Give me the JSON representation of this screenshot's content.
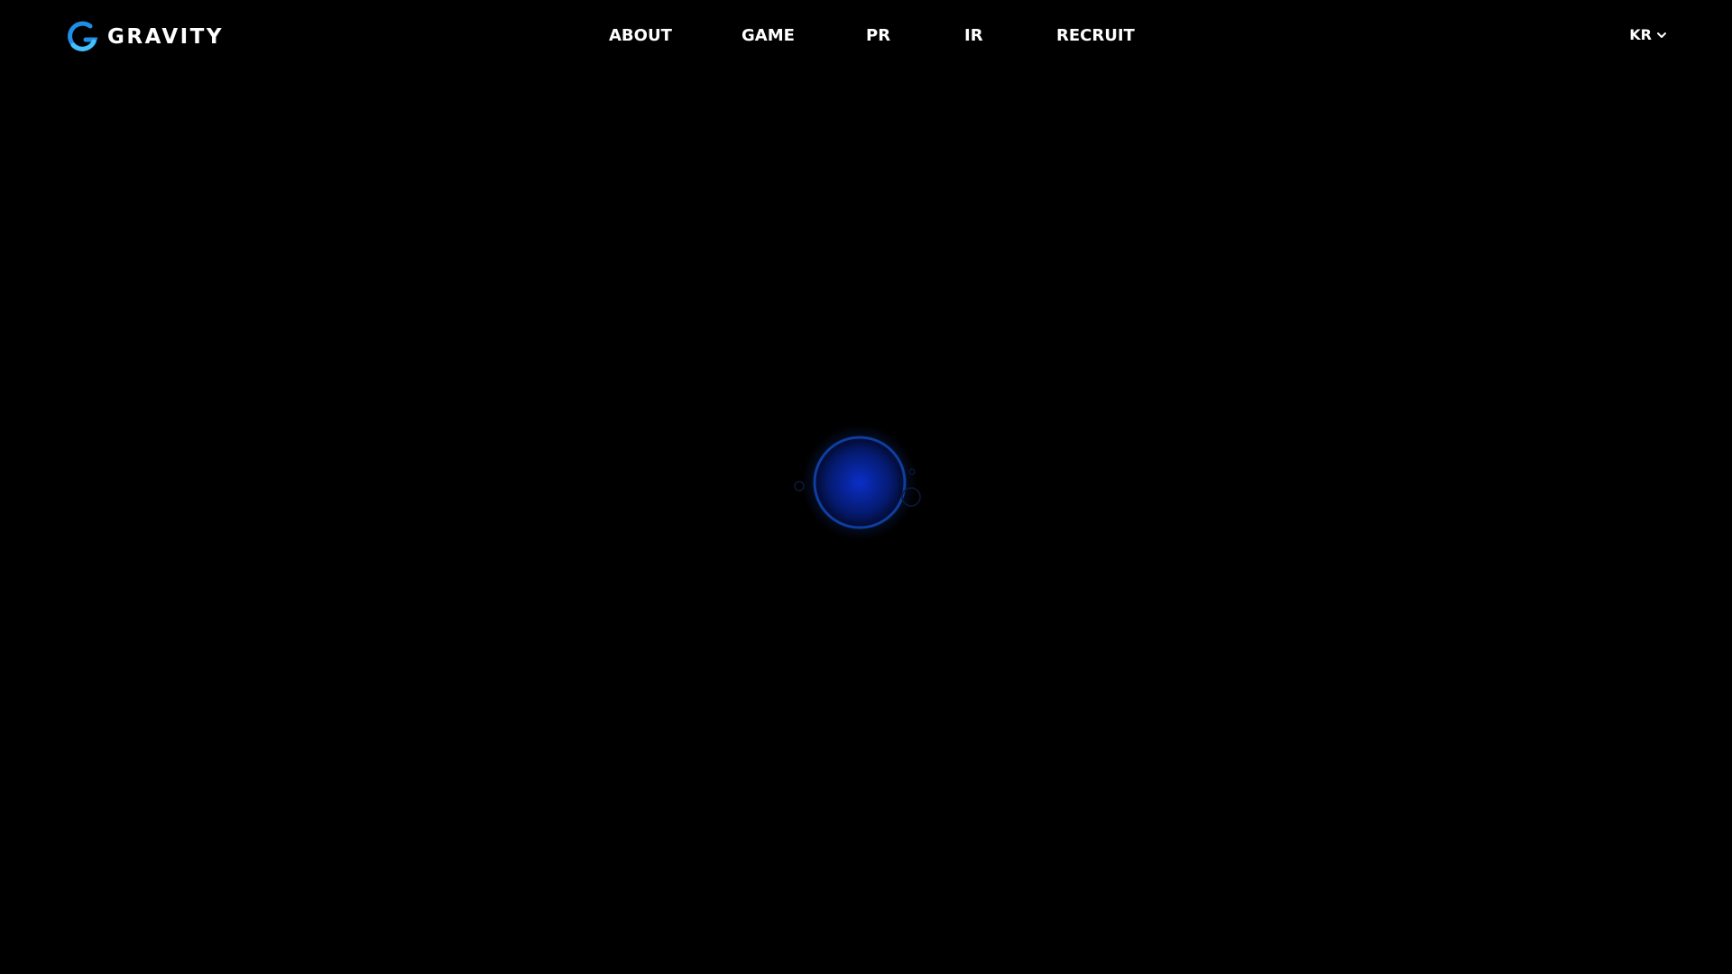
{
  "header": {
    "logo": {
      "text": "GRAVITY",
      "icon": "gravity-g-logo-icon",
      "colors": [
        "#1e8fe6",
        "#45c0ff",
        "#ffffff"
      ]
    },
    "nav": [
      {
        "label": "ABOUT"
      },
      {
        "label": "GAME"
      },
      {
        "label": "PR"
      },
      {
        "label": "IR"
      },
      {
        "label": "RECRUIT"
      }
    ],
    "language": {
      "selected": "KR",
      "icon": "chevron-down-icon"
    }
  },
  "loader": {
    "icon": "glowing-orb-loading-icon",
    "colors": {
      "core": "#0a2fc8",
      "ring": "#0e3ea0",
      "glow": "#1a5cff",
      "background": "#000000"
    }
  }
}
